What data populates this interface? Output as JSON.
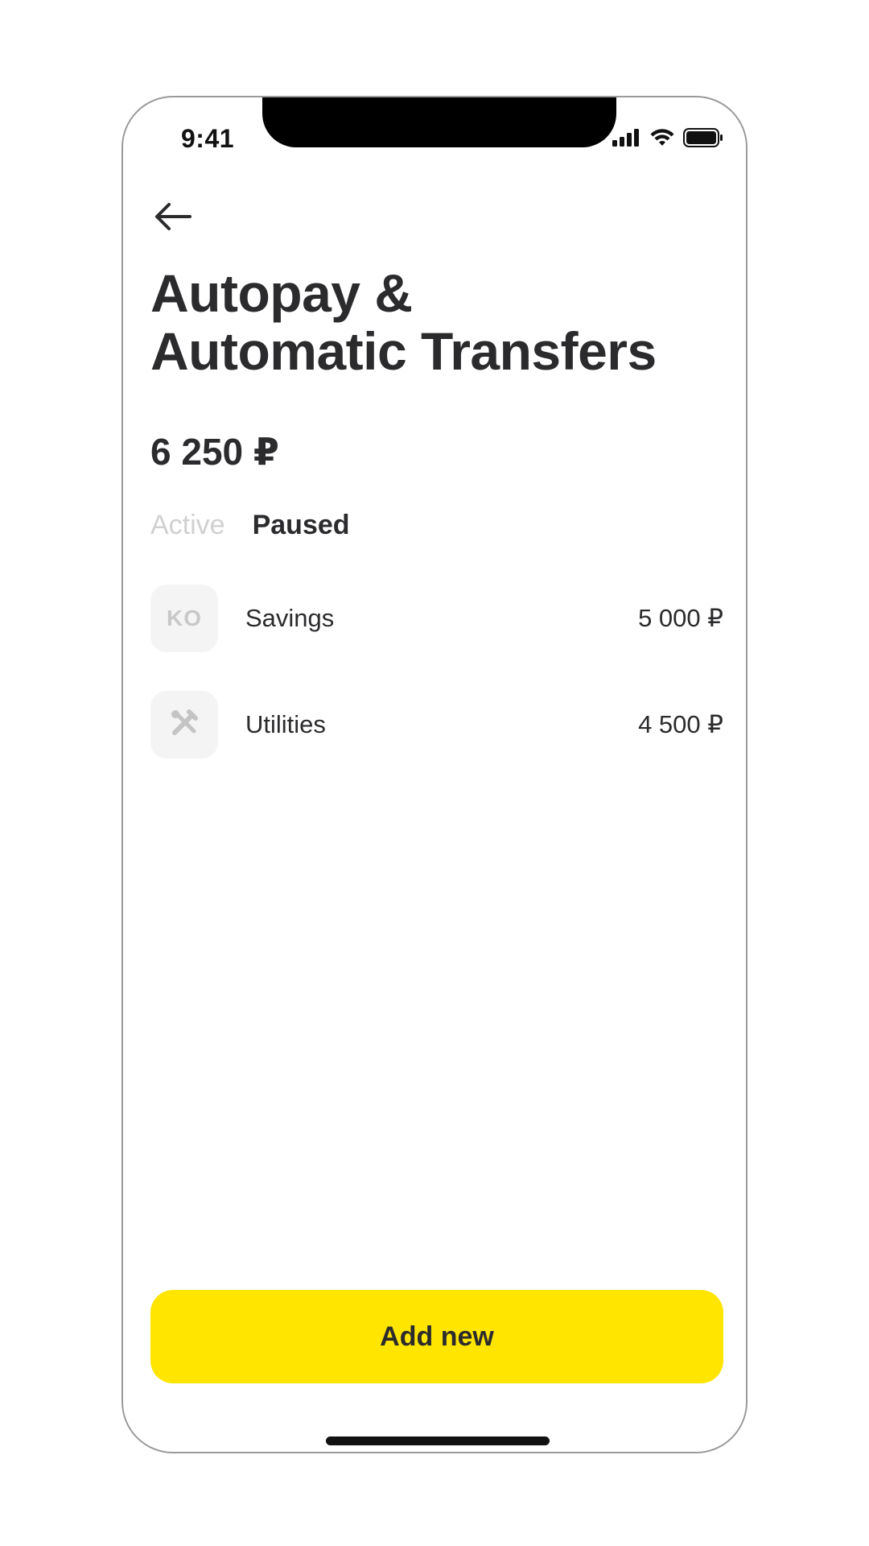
{
  "status_bar": {
    "time": "9:41",
    "icons": [
      "cellular-signal-icon",
      "wifi-icon",
      "battery-icon"
    ]
  },
  "header": {
    "back_icon": "arrow-left-icon",
    "title_line1": "Autopay &",
    "title_line2": "Automatic Transfers"
  },
  "summary": {
    "total": "6 250 ₽"
  },
  "tabs": [
    {
      "label": "Active",
      "selected": false
    },
    {
      "label": "Paused",
      "selected": true
    }
  ],
  "items": [
    {
      "name": "Savings",
      "amount": "5 000 ₽",
      "icon_text": "KO",
      "icon": "monogram-icon"
    },
    {
      "name": "Utilities",
      "amount": "4 500 ₽",
      "icon": "tools-icon"
    }
  ],
  "actions": {
    "add_new_label": "Add new"
  },
  "colors": {
    "accent": "#ffe500",
    "text": "#2b2b2e",
    "inactive_tab": "#d0d0d0",
    "icon_bg": "#f4f4f4"
  }
}
